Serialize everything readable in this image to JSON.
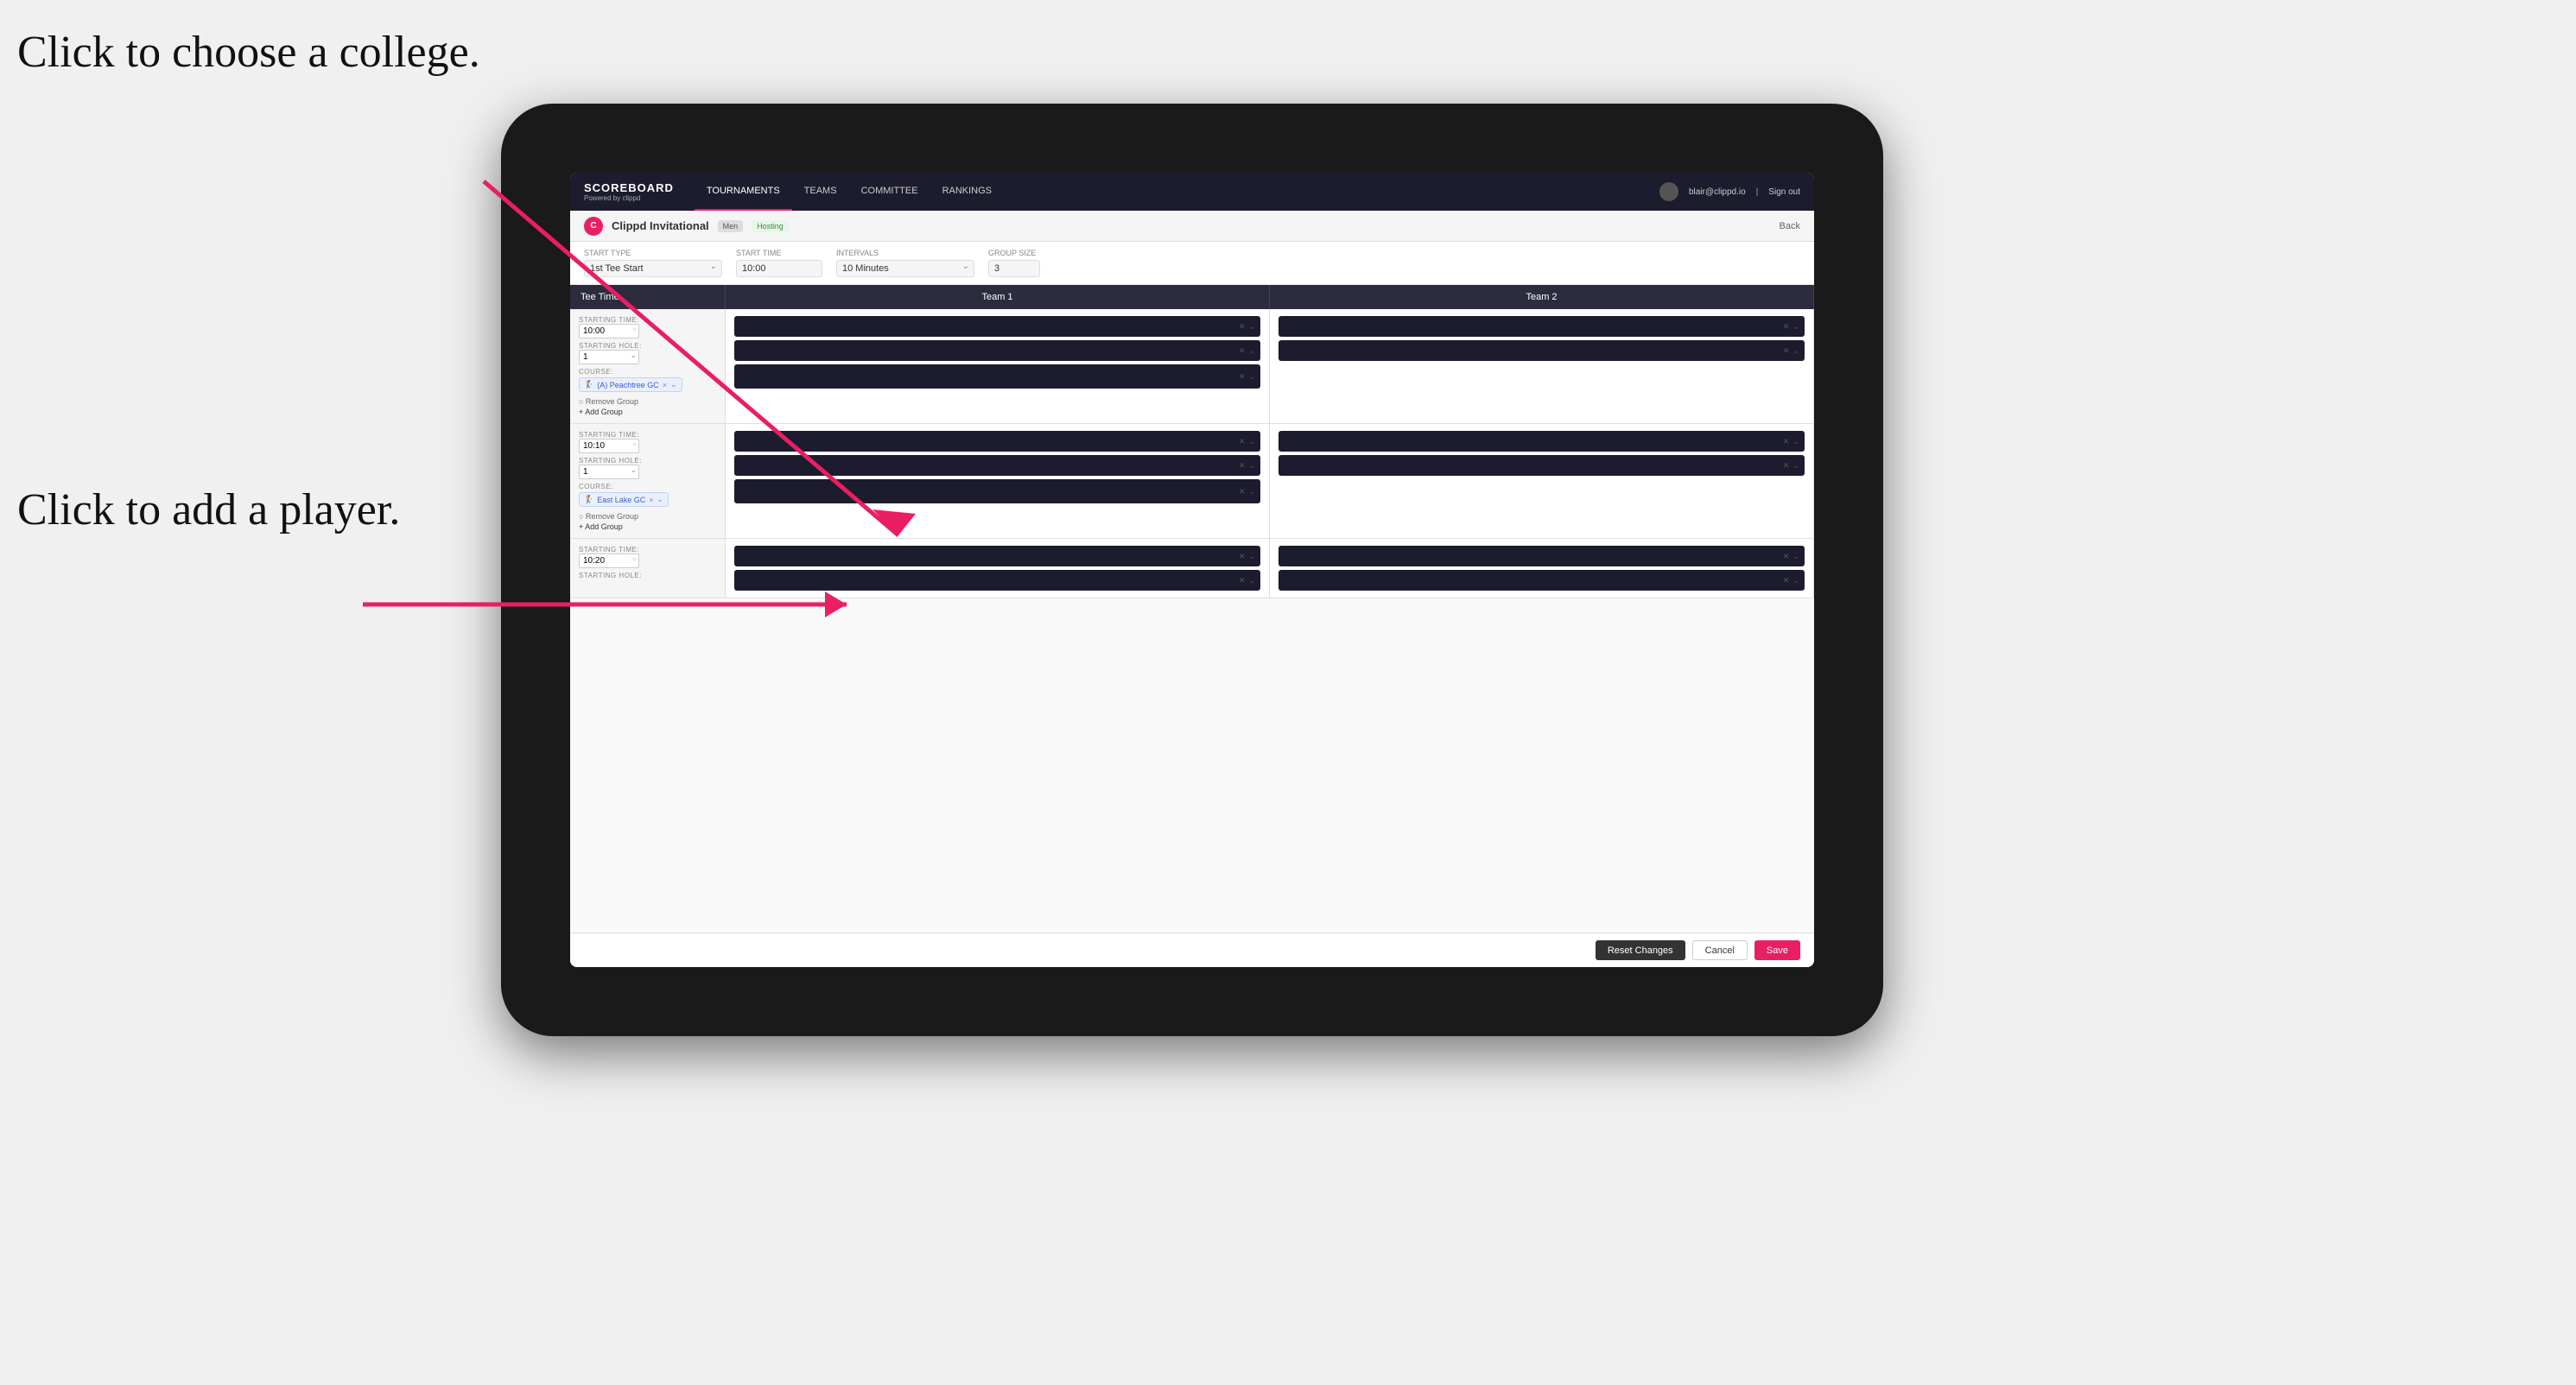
{
  "annotations": {
    "top": "Click to choose a college.",
    "bottom": "Click to add a player."
  },
  "header": {
    "logo_title": "SCOREBOARD",
    "logo_subtitle": "Powered by clippd",
    "nav_tabs": [
      "TOURNAMENTS",
      "TEAMS",
      "COMMITTEE",
      "RANKINGS"
    ],
    "active_tab": "TOURNAMENTS",
    "user_email": "blair@clippd.io",
    "sign_out": "Sign out"
  },
  "sub_header": {
    "tournament_name": "Clippd Invitational",
    "gender_badge": "Men",
    "hosting_badge": "Hosting",
    "back_label": "Back"
  },
  "controls": {
    "start_type_label": "Start Type",
    "start_type_value": "1st Tee Start",
    "start_time_label": "Start Time",
    "start_time_value": "10:00",
    "intervals_label": "Intervals",
    "intervals_value": "10 Minutes",
    "group_size_label": "Group Size",
    "group_size_value": "3"
  },
  "table": {
    "col_tee_time": "Tee Time",
    "col_team1": "Team 1",
    "col_team2": "Team 2"
  },
  "groups": [
    {
      "starting_time_label": "STARTING TIME:",
      "starting_time_value": "10:00",
      "starting_hole_label": "STARTING HOLE:",
      "starting_hole_value": "1",
      "course_label": "COURSE:",
      "course_tag": "(A) Peachtree GC",
      "remove_group": "Remove Group",
      "add_group": "+ Add Group",
      "team1_players": [
        {
          "id": "p1"
        },
        {
          "id": "p2"
        }
      ],
      "team2_players": [
        {
          "id": "p3"
        },
        {
          "id": "p4"
        }
      ],
      "team1_course_slots": 1,
      "team2_course_slots": 0
    },
    {
      "starting_time_label": "STARTING TIME:",
      "starting_time_value": "10:10",
      "starting_hole_label": "STARTING HOLE:",
      "starting_hole_value": "1",
      "course_label": "COURSE:",
      "course_tag": "East Lake GC",
      "remove_group": "Remove Group",
      "add_group": "+ Add Group",
      "team1_players": [
        {
          "id": "p5"
        },
        {
          "id": "p6"
        }
      ],
      "team2_players": [
        {
          "id": "p7"
        },
        {
          "id": "p8"
        }
      ],
      "team1_course_slots": 1,
      "team2_course_slots": 0
    },
    {
      "starting_time_label": "STARTING TIME:",
      "starting_time_value": "10:20",
      "starting_hole_label": "STARTING HOLE:",
      "starting_hole_value": "",
      "course_label": "",
      "course_tag": "",
      "remove_group": "",
      "add_group": "",
      "team1_players": [
        {
          "id": "p9"
        },
        {
          "id": "p10"
        }
      ],
      "team2_players": [
        {
          "id": "p11"
        },
        {
          "id": "p12"
        }
      ],
      "team1_course_slots": 0,
      "team2_course_slots": 0
    }
  ],
  "footer": {
    "reset_label": "Reset Changes",
    "cancel_label": "Cancel",
    "save_label": "Save"
  }
}
